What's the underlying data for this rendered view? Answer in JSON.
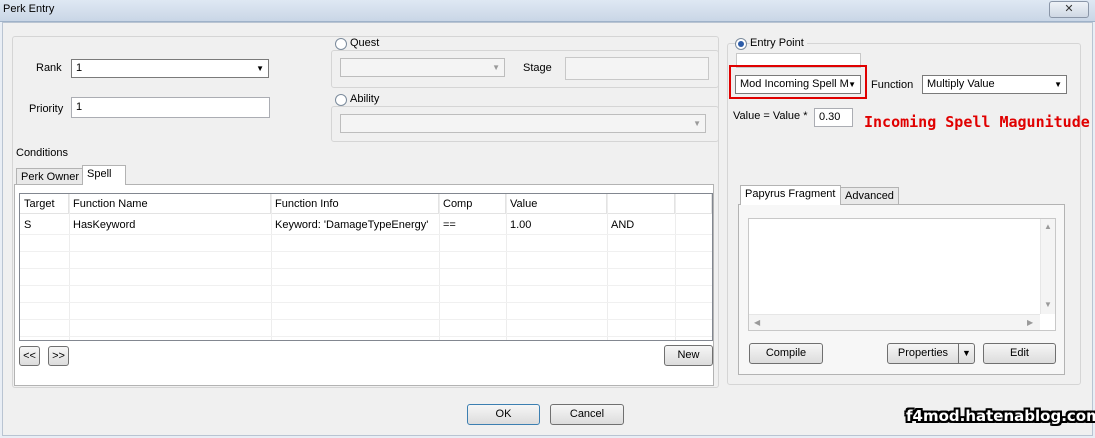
{
  "window": {
    "title": "Perk Entry",
    "close_glyph": "✕"
  },
  "left": {
    "rank_label": "Rank",
    "rank_value": "1",
    "priority_label": "Priority",
    "priority_value": "1",
    "conditions_label": "Conditions"
  },
  "quest": {
    "label": "Quest",
    "stage_label": "Stage",
    "quest_value": "",
    "stage_value": "",
    "selected": false
  },
  "ability": {
    "label": "Ability",
    "value": "",
    "selected": false
  },
  "conditions": {
    "tabs": [
      {
        "label": "Perk Owner",
        "active": false
      },
      {
        "label": "Spell",
        "active": true
      }
    ],
    "columns": [
      "Target",
      "Function Name",
      "Function Info",
      "Comp",
      "Value",
      ""
    ],
    "rows": [
      {
        "target": "S",
        "function_name": "HasKeyword",
        "function_info": "Keyword: 'DamageTypeEnergy'",
        "comp": "==",
        "value": "1.00",
        "logic": "AND"
      }
    ],
    "prev_button": "<<",
    "next_button": ">>",
    "new_button": "New"
  },
  "entry_point": {
    "label": "Entry Point",
    "selected": true,
    "entry_value": "Mod Incoming Spell M",
    "function_label": "Function",
    "function_value": "Multiply Value",
    "value_label": "Value = Value *",
    "value": "0.30",
    "annotation": "Incoming Spell Magunitude",
    "annotation_color": "#e00000"
  },
  "script": {
    "tabs": [
      {
        "label": "Papyrus Fragment",
        "active": true
      },
      {
        "label": "Advanced",
        "active": false
      }
    ],
    "compile_button": "Compile",
    "properties_button": "Properties",
    "edit_button": "Edit"
  },
  "footer": {
    "ok_button": "OK",
    "cancel_button": "Cancel"
  },
  "watermark": "f4mod.hatenablog.com"
}
